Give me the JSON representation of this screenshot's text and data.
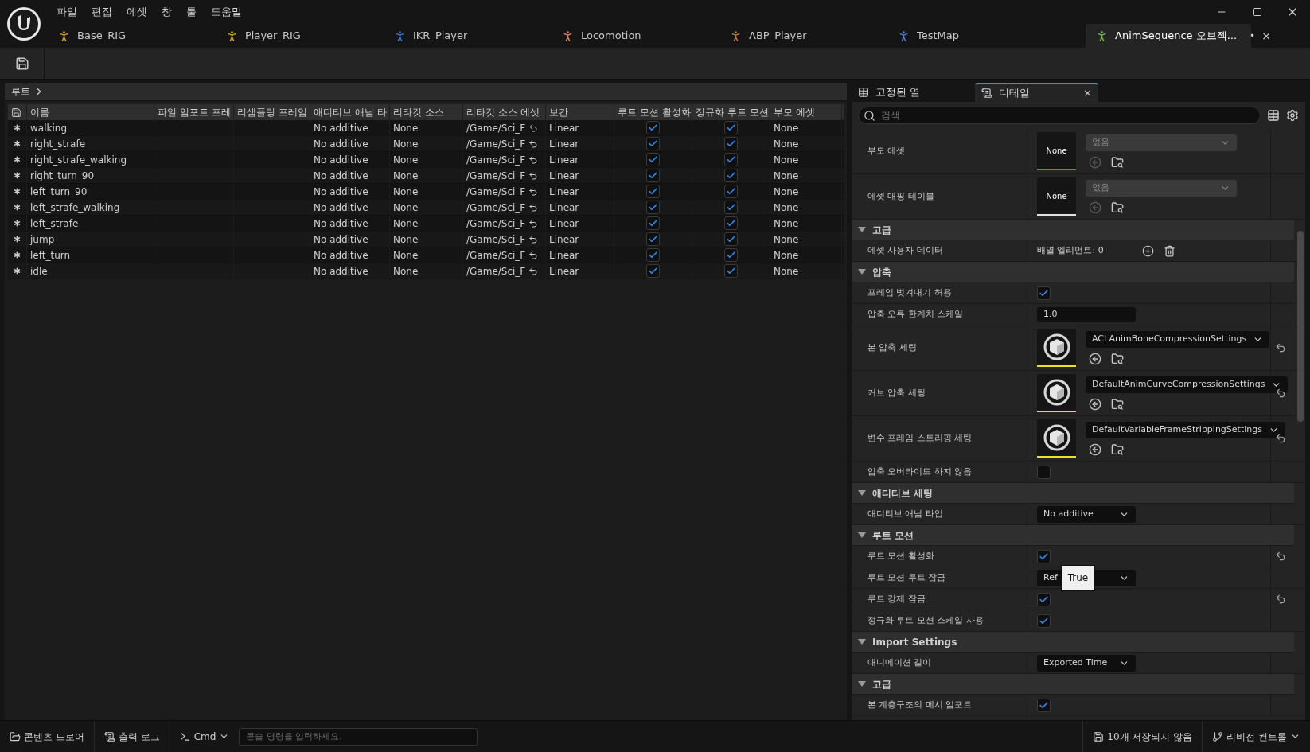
{
  "menu": [
    "파일",
    "편집",
    "에셋",
    "창",
    "툴",
    "도움말"
  ],
  "tabs": [
    {
      "label": "Base_RIG",
      "selected": false,
      "color": "#d9a520"
    },
    {
      "label": "Player_RIG",
      "selected": false,
      "color": "#d9a520"
    },
    {
      "label": "IKR_Player",
      "selected": false,
      "color": "#3a7bd5"
    },
    {
      "label": "Locomotion",
      "selected": false,
      "color": "#e08a5a"
    },
    {
      "label": "ABP_Player",
      "selected": false,
      "color": "#c87a20"
    },
    {
      "label": "TestMap",
      "selected": false,
      "color": "#4a7fe0"
    },
    {
      "label": "AnimSequence 오브젝...",
      "selected": true,
      "color": "#6fbf4a",
      "dirty_mark": "•",
      "close": "×"
    }
  ],
  "breadcrumb": "루트",
  "table": {
    "columns": [
      "이름",
      "파일 임포트 프레",
      "리샘플링 프레임",
      "애디티브 애님 타",
      "리타깃 소스",
      "리타깃 소스 에셋",
      "보간",
      "루트 모션 활성화",
      "정규화 루트 모션",
      "부모 에셋"
    ],
    "rows": [
      {
        "name": "walking",
        "additive": "No additive",
        "retarget_source": "None",
        "retarget_asset": "/Game/Sci_F",
        "interpolation": "Linear",
        "root_motion": true,
        "normalize": true,
        "parent": "None"
      },
      {
        "name": "right_strafe",
        "additive": "No additive",
        "retarget_source": "None",
        "retarget_asset": "/Game/Sci_F",
        "interpolation": "Linear",
        "root_motion": true,
        "normalize": true,
        "parent": "None"
      },
      {
        "name": "right_strafe_walking",
        "additive": "No additive",
        "retarget_source": "None",
        "retarget_asset": "/Game/Sci_F",
        "interpolation": "Linear",
        "root_motion": true,
        "normalize": true,
        "parent": "None"
      },
      {
        "name": "right_turn_90",
        "additive": "No additive",
        "retarget_source": "None",
        "retarget_asset": "/Game/Sci_F",
        "interpolation": "Linear",
        "root_motion": true,
        "normalize": true,
        "parent": "None"
      },
      {
        "name": "left_turn_90",
        "additive": "No additive",
        "retarget_source": "None",
        "retarget_asset": "/Game/Sci_F",
        "interpolation": "Linear",
        "root_motion": true,
        "normalize": true,
        "parent": "None"
      },
      {
        "name": "left_strafe_walking",
        "additive": "No additive",
        "retarget_source": "None",
        "retarget_asset": "/Game/Sci_F",
        "interpolation": "Linear",
        "root_motion": true,
        "normalize": true,
        "parent": "None"
      },
      {
        "name": "left_strafe",
        "additive": "No additive",
        "retarget_source": "None",
        "retarget_asset": "/Game/Sci_F",
        "interpolation": "Linear",
        "root_motion": true,
        "normalize": true,
        "parent": "None"
      },
      {
        "name": "jump",
        "additive": "No additive",
        "retarget_source": "None",
        "retarget_asset": "/Game/Sci_F",
        "interpolation": "Linear",
        "root_motion": true,
        "normalize": true,
        "parent": "None"
      },
      {
        "name": "left_turn",
        "additive": "No additive",
        "retarget_source": "None",
        "retarget_asset": "/Game/Sci_F",
        "interpolation": "Linear",
        "root_motion": true,
        "normalize": true,
        "parent": "None"
      },
      {
        "name": "idle",
        "additive": "No additive",
        "retarget_source": "None",
        "retarget_asset": "/Game/Sci_F",
        "interpolation": "Linear",
        "root_motion": true,
        "normalize": true,
        "parent": "None"
      }
    ]
  },
  "details": {
    "tabs": [
      {
        "label": "고정된 열",
        "selected": false
      },
      {
        "label": "디테일",
        "selected": true,
        "close": "×"
      }
    ],
    "search": {
      "placeholder": "검색"
    },
    "rows": [
      {
        "kind": "asset",
        "label": "부모 에셋",
        "thumbnail_label": "None",
        "value": "없음",
        "disabled": true,
        "color": "#4a9a4a",
        "reset": false
      },
      {
        "kind": "asset",
        "label": "에셋 매핑 테이블",
        "thumbnail_label": "None",
        "value": "없음",
        "disabled": true,
        "color": "#e0e0e0",
        "reset": false
      },
      {
        "kind": "section",
        "label": "고급",
        "expanded": true
      },
      {
        "kind": "array",
        "label": "에셋 사용자 데이터",
        "value": "배열 엘리먼트: 0",
        "reset": false
      },
      {
        "kind": "section",
        "label": "압축",
        "expanded": true
      },
      {
        "kind": "checkbox",
        "label": "프레임 벗겨내기 허용",
        "checked": true,
        "reset": false
      },
      {
        "kind": "number",
        "label": "압축 오류 한계치 스케일",
        "value": "1.0",
        "reset": false
      },
      {
        "kind": "asset",
        "label": "본 압축 세팅",
        "value": "ACLAnimBoneCompressionSettings",
        "disabled": false,
        "color": "#f0e020",
        "reset": true
      },
      {
        "kind": "asset",
        "label": "커브 압축 세팅",
        "value": "DefaultAnimCurveCompressionSettings",
        "disabled": false,
        "color": "#f0e020",
        "reset": true
      },
      {
        "kind": "asset",
        "label": "변수 프레임 스트리핑 세팅",
        "value": "DefaultVariableFrameStrippingSettings",
        "disabled": false,
        "color": "#f0e020",
        "reset": true
      },
      {
        "kind": "checkbox",
        "label": "압축 오버라이드 하지 않음",
        "checked": false,
        "reset": false
      },
      {
        "kind": "section",
        "label": "애디티브 세팅",
        "expanded": true
      },
      {
        "kind": "combo",
        "label": "애디티브 애님 타입",
        "value": "No additive",
        "reset": false
      },
      {
        "kind": "section",
        "label": "루트 모션",
        "expanded": true
      },
      {
        "kind": "checkbox",
        "label": "루트 모션 활성화",
        "checked": true,
        "reset": true
      },
      {
        "kind": "combo",
        "label": "루트 모션 루트 잠금",
        "value": "Ref",
        "tooltip": "True",
        "reset": false
      },
      {
        "kind": "checkbox",
        "label": "루트 강제 잠금",
        "checked": true,
        "reset": true
      },
      {
        "kind": "checkbox",
        "label": "정규화 루트 모션 스케일 사용",
        "checked": true,
        "reset": false
      },
      {
        "kind": "section",
        "label": "Import Settings",
        "expanded": true
      },
      {
        "kind": "combo",
        "label": "애니메이션 길이",
        "value": "Exported Time",
        "reset": false
      },
      {
        "kind": "section",
        "label": "고급",
        "expanded": true
      },
      {
        "kind": "checkbox",
        "label": "본 계층구조의 메시 임포트",
        "checked": true,
        "reset": false
      }
    ]
  },
  "status_bar": {
    "content_drawer": "콘텐츠 드로어",
    "output_log": "출력 로그",
    "cmd": "Cmd",
    "console": {
      "placeholder": "콘솔 명령을 입력하세요."
    },
    "unsaved": "10개 저장되지 않음",
    "revision": "리비전 컨트롤"
  }
}
